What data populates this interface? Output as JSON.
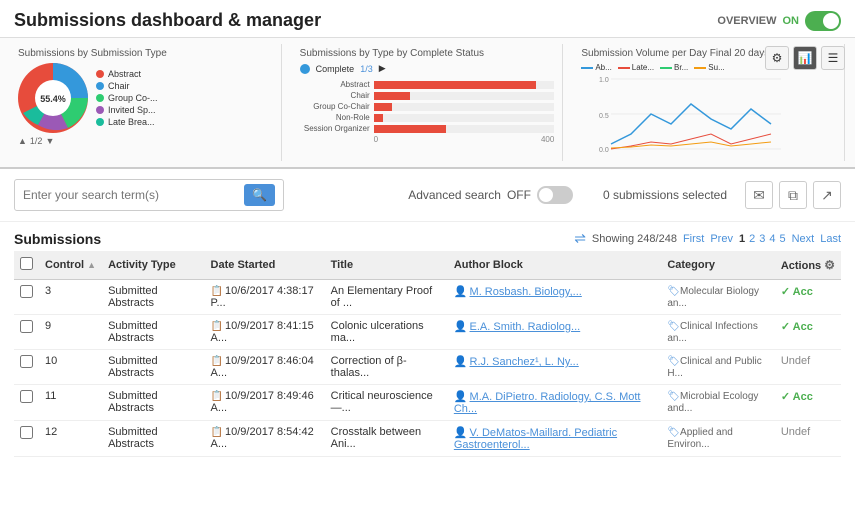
{
  "header": {
    "title": "Submissions dashboard & manager",
    "overview_label": "OVERVIEW",
    "on_label": "ON"
  },
  "charts": {
    "pie_chart": {
      "title": "Submissions by Submission Type",
      "center_label": "55.4%",
      "nav": "1/2",
      "legend": [
        {
          "label": "Abstract",
          "color": "#e74c3c"
        },
        {
          "label": "Chair",
          "color": "#3498db"
        },
        {
          "label": "Group Co-...",
          "color": "#2ecc71"
        },
        {
          "label": "Invited Sp...",
          "color": "#9b59b6"
        },
        {
          "label": "Late Brea...",
          "color": "#1abc9c"
        }
      ]
    },
    "bar_chart": {
      "title": "Submissions by Type by Complete Status",
      "complete_label": "Complete",
      "fraction": "1/3",
      "rows": [
        {
          "label": "Abstract",
          "value": 90,
          "max": 100
        },
        {
          "label": "Chair",
          "value": 10,
          "max": 100
        },
        {
          "label": "Group Co-Chair",
          "value": 5,
          "max": 100
        },
        {
          "label": "Non-Role",
          "value": 2,
          "max": 100
        },
        {
          "label": "Session Organizer",
          "value": 40,
          "max": 100
        }
      ],
      "axis_start": "0",
      "axis_end": "400"
    },
    "line_chart": {
      "title": "Submission Volume per Day Final 20 days",
      "legend": [
        {
          "label": "Ab...",
          "color": "#3498db"
        },
        {
          "label": "Late...",
          "color": "#e74c3c"
        },
        {
          "label": "Br...",
          "color": "#2ecc71"
        },
        {
          "label": "Su...",
          "color": "#f39c12"
        }
      ],
      "y_max": "1.0",
      "y_mid": "0.5",
      "y_min": "0.0"
    }
  },
  "search": {
    "placeholder": "Enter your search term(s)",
    "advanced_search_label": "Advanced search",
    "off_label": "OFF",
    "submissions_selected": "0 submissions selected"
  },
  "table": {
    "title": "Submissions",
    "showing_label": "Showing 248/248",
    "pagination": {
      "first": "First",
      "prev": "Prev",
      "pages": [
        "1",
        "2",
        "3",
        "4",
        "5"
      ],
      "next": "Next",
      "last": "Last",
      "active_page": "1"
    },
    "columns": [
      "",
      "Control",
      "Activity Type",
      "Date Started",
      "Title",
      "Author Block",
      "Category",
      "Actions"
    ],
    "rows": [
      {
        "id": "3",
        "activity_type": "Submitted Abstracts",
        "date_started": "10/6/2017 4:38:17 P...",
        "title": "An Elementary Proof of ...",
        "author_block": "M. Rosbash. Biology,...",
        "category": "Molecular Biology an...",
        "action": "Acc",
        "action_type": "accepted"
      },
      {
        "id": "9",
        "activity_type": "Submitted Abstracts",
        "date_started": "10/9/2017 8:41:15 A...",
        "title": "Colonic ulcerations ma...",
        "author_block": "E.A. Smith. Radiolog...",
        "category": "Clinical Infections an...",
        "action": "Acc",
        "action_type": "accepted"
      },
      {
        "id": "10",
        "activity_type": "Submitted Abstracts",
        "date_started": "10/9/2017 8:46:04 A...",
        "title": "Correction of β-thalas...",
        "author_block": "R.J. Sanchez¹, L. Ny...",
        "category": "Clinical and Public H...",
        "action": "Undef",
        "action_type": "undef"
      },
      {
        "id": "11",
        "activity_type": "Submitted Abstracts",
        "date_started": "10/9/2017 8:49:46 A...",
        "title": "Critical neuroscience—...",
        "author_block": "M.A. DiPietro. Radiology, C.S. Mott Ch...",
        "category": "Microbial Ecology and...",
        "action": "Acc",
        "action_type": "accepted"
      },
      {
        "id": "12",
        "activity_type": "Submitted Abstracts",
        "date_started": "10/9/2017 8:54:42 A...",
        "title": "Crosstalk between Ani...",
        "author_block": "V. DeMatos-Maillard. Pediatric Gastroenterol...",
        "category": "Applied and Environ...",
        "action": "Undef",
        "action_type": "undef"
      }
    ]
  }
}
